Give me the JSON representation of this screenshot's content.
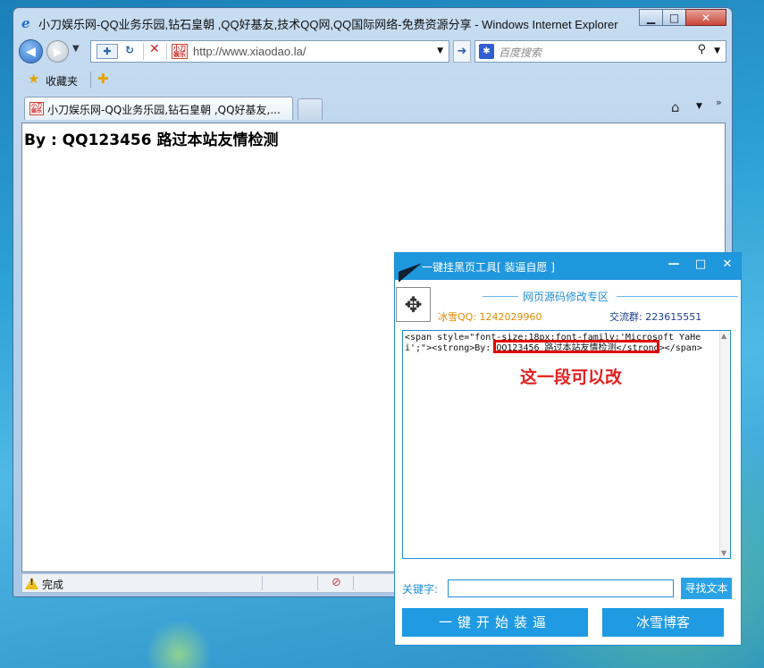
{
  "browser": {
    "window_title": "小刀娱乐网-QQ业务乐园,钻石皇朝 ,QQ好基友,技术QQ网,QQ国际网络-免费资源分享 - Windows Internet Explorer",
    "address": "http://www.xiaodao.la/",
    "search_placeholder": "百度搜索",
    "favorites_label": "收藏夹",
    "tab_title": "小刀娱乐网-QQ业务乐园,钻石皇朝 ,QQ好基友,...",
    "favicon_text": "小刀娱乐",
    "status_text": "完成"
  },
  "page": {
    "heading": "By : QQ123456 路过本站友情检测"
  },
  "tool": {
    "title": "一键挂黑页工具[ 装逼自愿 ]",
    "section_title": "网页源码修改专区",
    "qq_info": "冰雪QQ: 1242029960",
    "group_info": "交流群: 223615551",
    "code": "<span style=\"font-size:18px;font-family:'Microsoft YaHei';\"><strong>By: QQ123456 路过本站友情检测</strong></span>",
    "annotation": "这一段可以改",
    "keyword_label": "关键字:",
    "keyword_value": "",
    "find_button": "寻找文本",
    "go_button": "一键开始装逼",
    "blog_button": "冰雪博客"
  },
  "colors": {
    "tool_accent": "#1f97dd",
    "annotation_red": "#e32020"
  }
}
